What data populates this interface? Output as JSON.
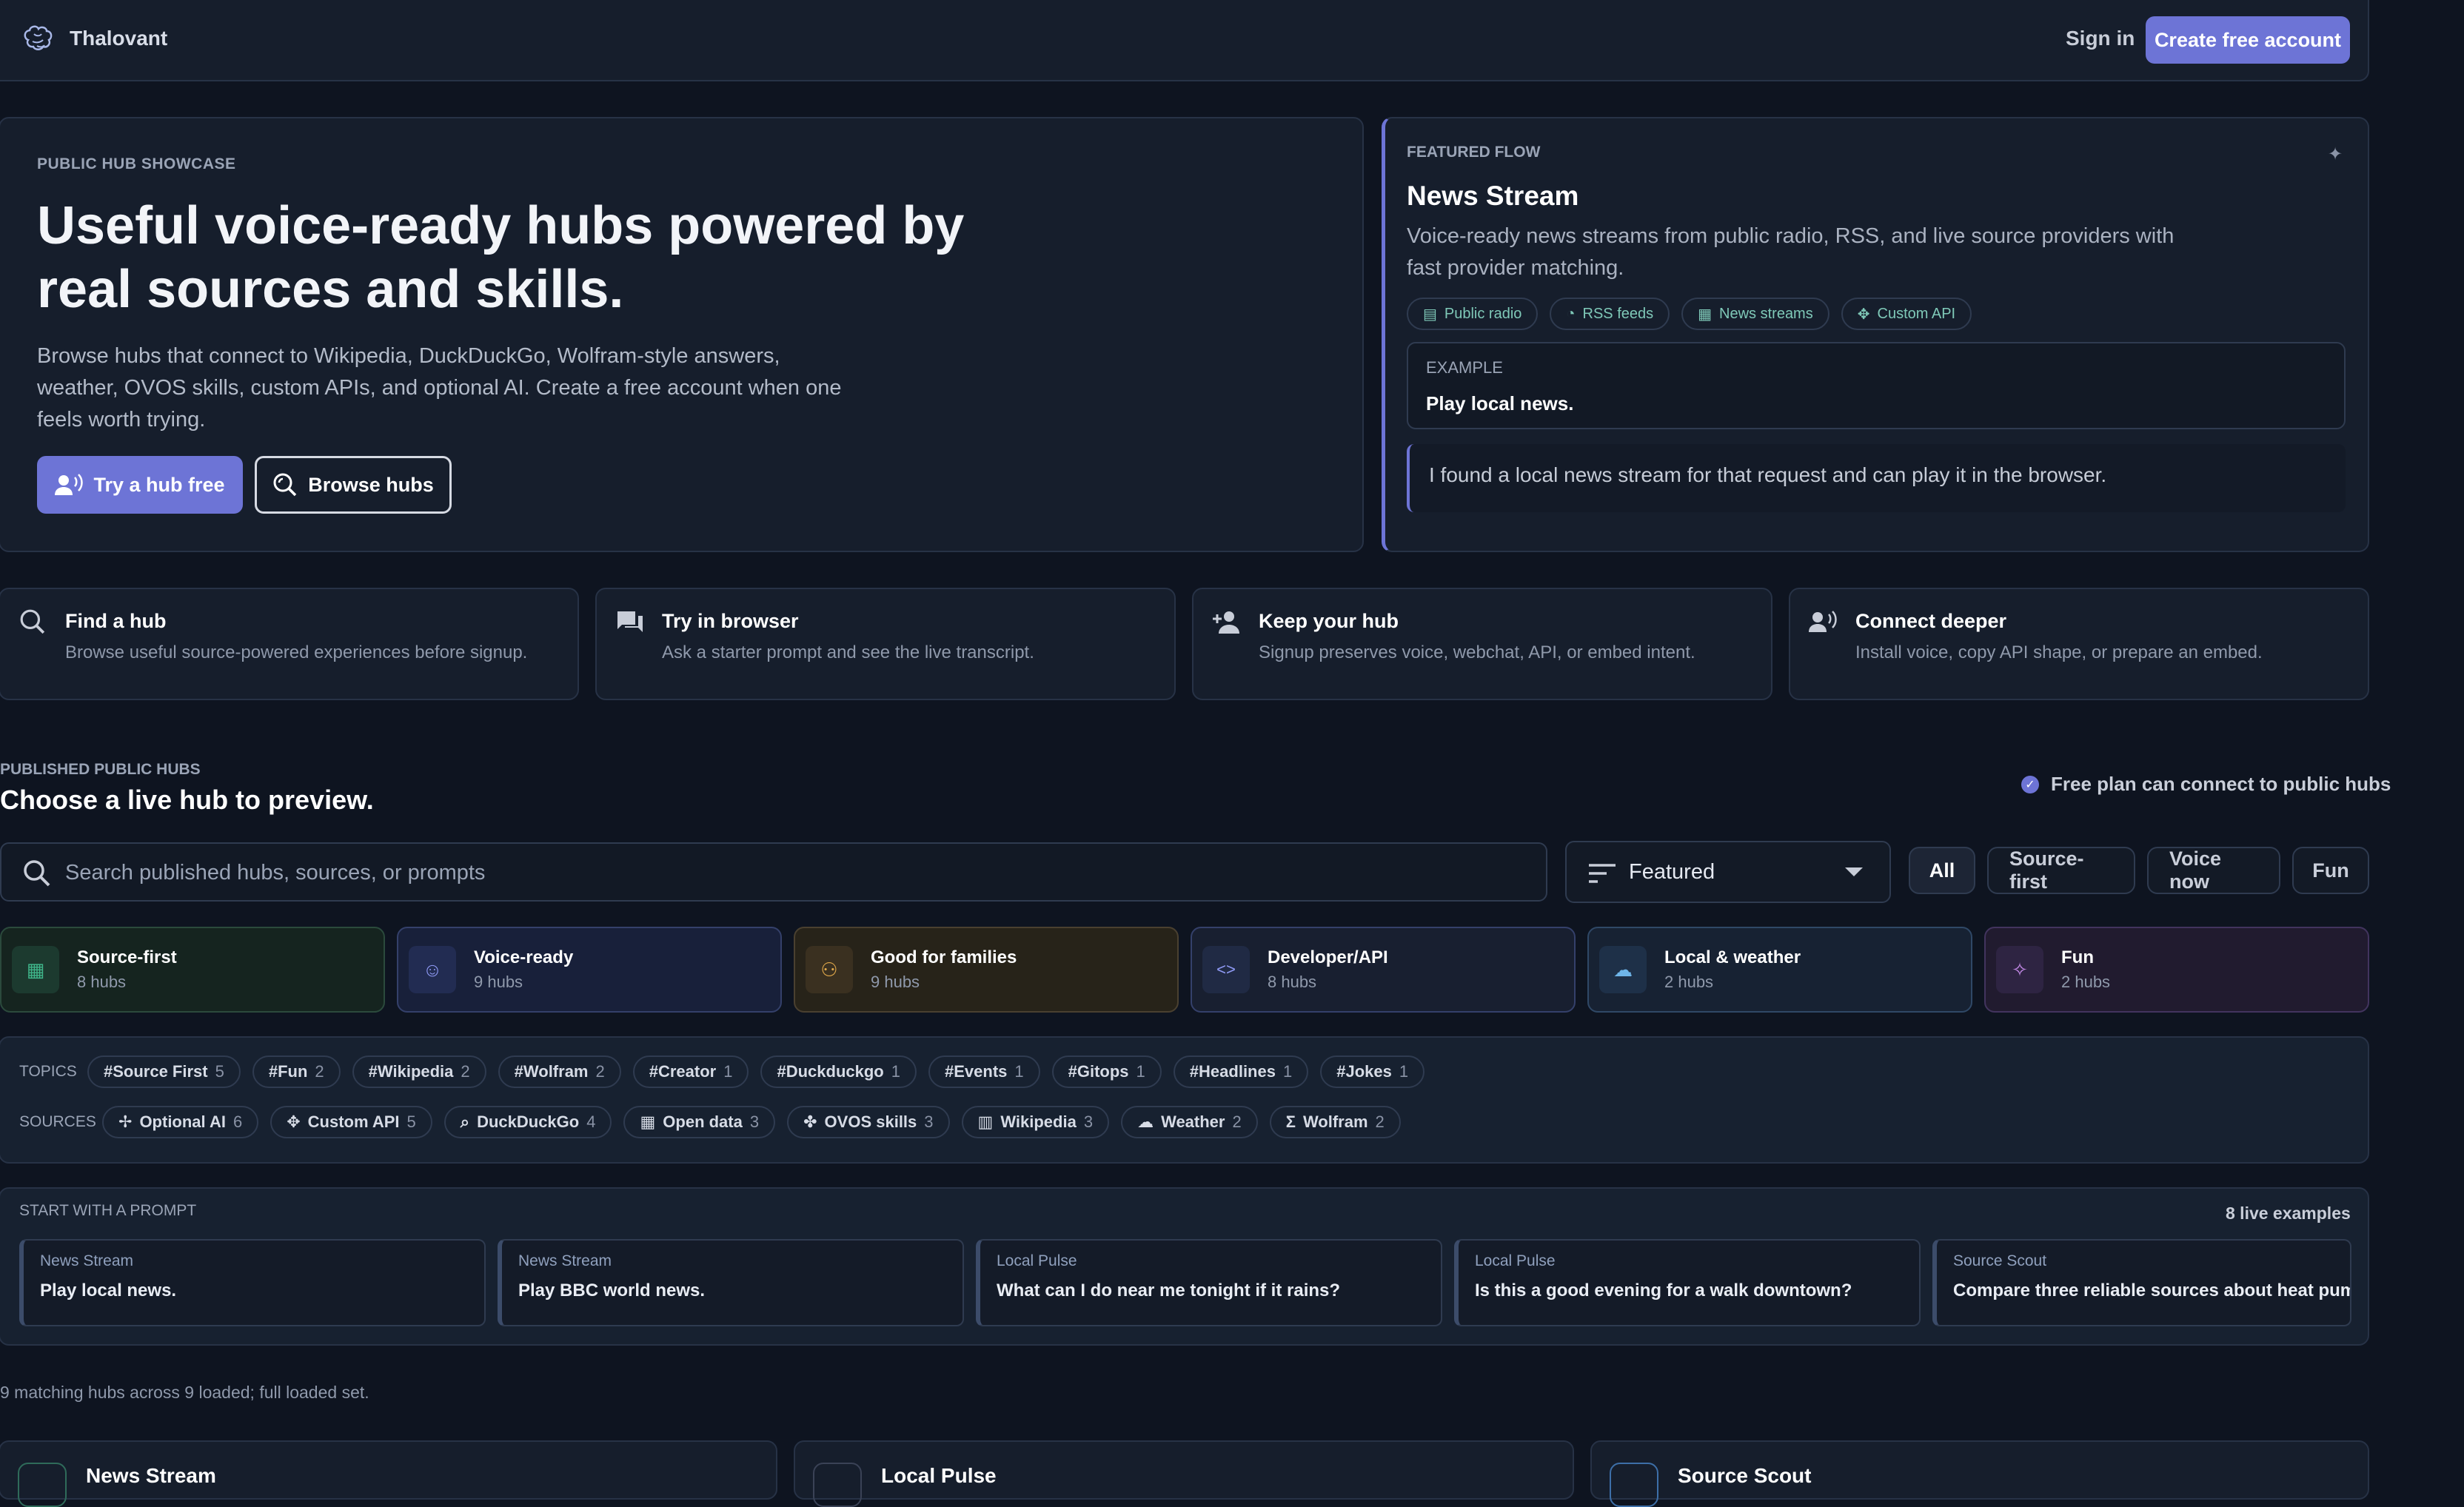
{
  "brand": {
    "name": "Thalovant"
  },
  "nav": {
    "sign_in": "Sign in",
    "create_account": "Create free account"
  },
  "hero": {
    "eyebrow": "PUBLIC HUB SHOWCASE",
    "title": "Useful voice-ready hubs powered by real sources and skills.",
    "description": "Browse hubs that connect to Wikipedia, DuckDuckGo, Wolfram-style answers, weather, OVOS skills, custom APIs, and optional AI. Create a free account when one feels worth trying.",
    "try_button": "Try a hub free",
    "browse_button": "Browse hubs"
  },
  "featured": {
    "eyebrow": "FEATURED FLOW",
    "title": "News Stream",
    "description": "Voice-ready news streams from public radio, RSS, and live source providers with fast provider matching.",
    "tags": [
      {
        "label": "Public radio",
        "icon": "radio-icon"
      },
      {
        "label": "RSS feeds",
        "icon": "rss-icon"
      },
      {
        "label": "News streams",
        "icon": "newspaper-icon"
      },
      {
        "label": "Custom API",
        "icon": "api-icon"
      }
    ],
    "example_label": "EXAMPLE",
    "example_text": "Play local news.",
    "reply": "I found a local news stream for that request and can play it in the browser."
  },
  "steps": [
    {
      "title": "Find a hub",
      "desc": "Browse useful source-powered experiences before signup.",
      "icon": "search-hub-icon"
    },
    {
      "title": "Try in browser",
      "desc": "Ask a starter prompt and see the live transcript.",
      "icon": "chat-icon"
    },
    {
      "title": "Keep your hub",
      "desc": "Signup preserves voice, webchat, API, or embed intent.",
      "icon": "add-person-icon"
    },
    {
      "title": "Connect deeper",
      "desc": "Install voice, copy API shape, or prepare an embed.",
      "icon": "voice-person-icon"
    }
  ],
  "hubs_section": {
    "eyebrow": "PUBLISHED PUBLIC HUBS",
    "title": "Choose a live hub to preview.",
    "free_plan": "Free plan can connect to public hubs",
    "search_placeholder": "Search published hubs, sources, or prompts",
    "sort_value": "Featured",
    "filters": [
      "All",
      "Source-first",
      "Voice now",
      "Fun"
    ],
    "active_filter": "All"
  },
  "categories": [
    {
      "title": "Source-first",
      "count": "8 hubs",
      "icon": "grid-icon",
      "color": "#3fb58a"
    },
    {
      "title": "Voice-ready",
      "count": "9 hubs",
      "icon": "voice-icon",
      "color": "#7f8cf0"
    },
    {
      "title": "Good for families",
      "count": "9 hubs",
      "icon": "family-icon",
      "color": "#e0a84a"
    },
    {
      "title": "Developer/API",
      "count": "8 hubs",
      "icon": "code-icon",
      "color": "#7f8cf0"
    },
    {
      "title": "Local & weather",
      "count": "2 hubs",
      "icon": "cloud-icon",
      "color": "#6fb6ea"
    },
    {
      "title": "Fun",
      "count": "2 hubs",
      "icon": "party-icon",
      "color": "#c58ae8"
    }
  ],
  "topics": {
    "label": "TOPICS",
    "items": [
      {
        "name": "#Source First",
        "count": "5"
      },
      {
        "name": "#Fun",
        "count": "2"
      },
      {
        "name": "#Wikipedia",
        "count": "2"
      },
      {
        "name": "#Wolfram",
        "count": "2"
      },
      {
        "name": "#Creator",
        "count": "1"
      },
      {
        "name": "#Duckduckgo",
        "count": "1"
      },
      {
        "name": "#Events",
        "count": "1"
      },
      {
        "name": "#Gitops",
        "count": "1"
      },
      {
        "name": "#Headlines",
        "count": "1"
      },
      {
        "name": "#Jokes",
        "count": "1"
      }
    ]
  },
  "sources": {
    "label": "SOURCES",
    "items": [
      {
        "name": "Optional AI",
        "count": "6",
        "icon": "sparkle-icon"
      },
      {
        "name": "Custom API",
        "count": "5",
        "icon": "api-icon"
      },
      {
        "name": "DuckDuckGo",
        "count": "4",
        "icon": "search-icon"
      },
      {
        "name": "Open data",
        "count": "3",
        "icon": "table-icon"
      },
      {
        "name": "OVOS skills",
        "count": "3",
        "icon": "puzzle-icon"
      },
      {
        "name": "Wikipedia",
        "count": "3",
        "icon": "book-icon"
      },
      {
        "name": "Weather",
        "count": "2",
        "icon": "cloud-icon"
      },
      {
        "name": "Wolfram",
        "count": "2",
        "icon": "sigma-icon"
      }
    ]
  },
  "prompts": {
    "label": "START WITH A PROMPT",
    "count": "8 live examples",
    "items": [
      {
        "source": "News Stream",
        "text": "Play local news."
      },
      {
        "source": "News Stream",
        "text": "Play BBC world news."
      },
      {
        "source": "Local Pulse",
        "text": "What can I do near me tonight if it rains?"
      },
      {
        "source": "Local Pulse",
        "text": "Is this a good evening for a walk downtown?"
      },
      {
        "source": "Source Scout",
        "text": "Compare three reliable sources about heat pumps"
      }
    ]
  },
  "results": {
    "summary": "9 matching hubs across 9 loaded; full loaded set.",
    "hubs": [
      {
        "title": "News Stream"
      },
      {
        "title": "Local Pulse"
      },
      {
        "title": "Source Scout"
      }
    ]
  }
}
